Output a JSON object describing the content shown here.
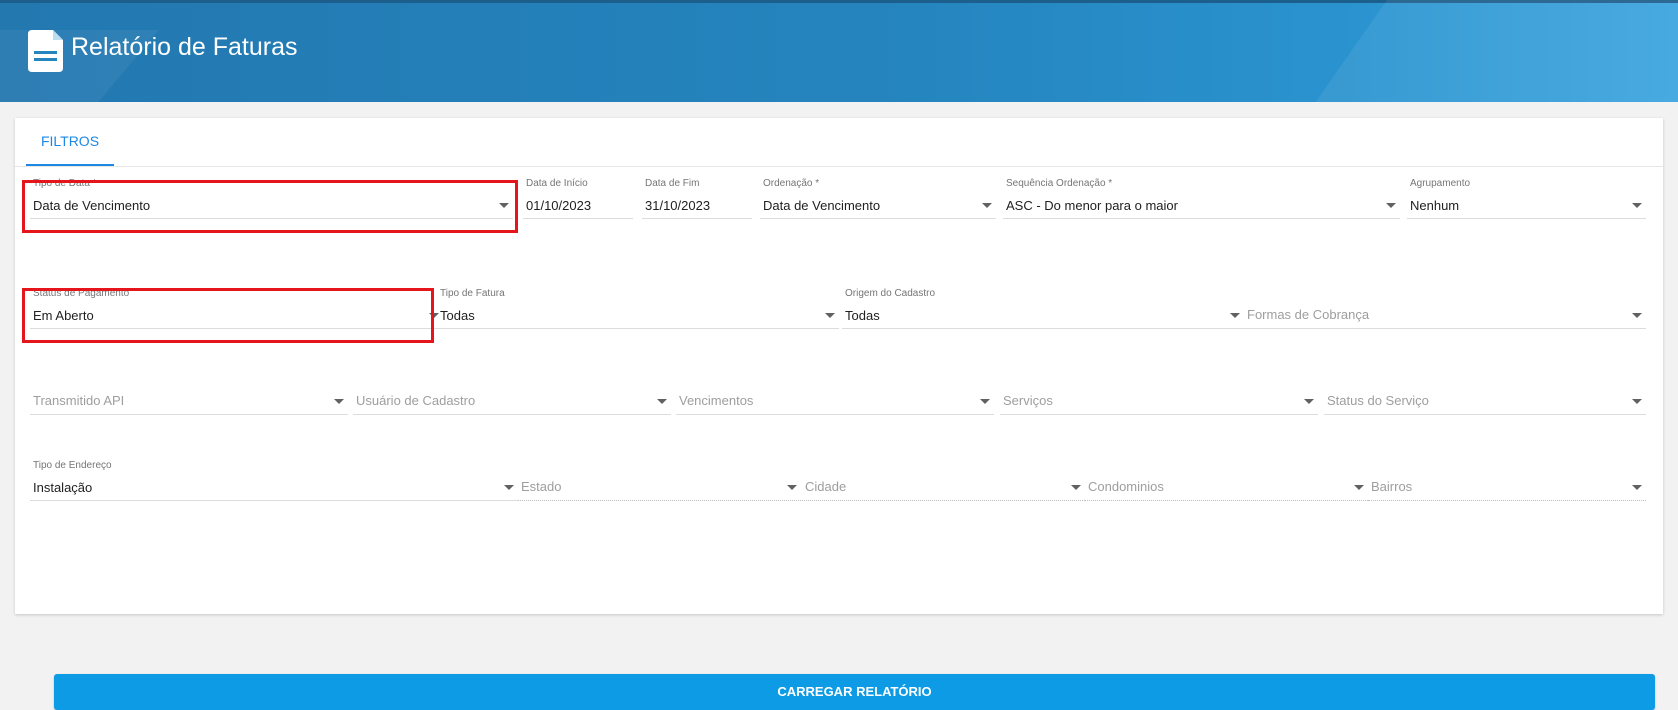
{
  "header": {
    "title": "Relatório de Faturas",
    "icon": "document-icon"
  },
  "tabs": [
    {
      "label": "FILTROS"
    }
  ],
  "filters": {
    "tipo_data": {
      "label": "Tipo de Data *",
      "value": "Data de Vencimento"
    },
    "data_inicio": {
      "label": "Data de Início",
      "value": "01/10/2023"
    },
    "data_fim": {
      "label": "Data de Fim",
      "value": "31/10/2023"
    },
    "ordenacao": {
      "label": "Ordenação *",
      "value": "Data de Vencimento"
    },
    "sequencia_ordenacao": {
      "label": "Sequência Ordenação *",
      "value": "ASC - Do menor para o maior"
    },
    "agrupamento": {
      "label": "Agrupamento",
      "value": "Nenhum"
    },
    "status_pagamento": {
      "label": "Status de Pagamento",
      "value": "Em Aberto"
    },
    "tipo_fatura": {
      "label": "Tipo de Fatura",
      "value": "Todas"
    },
    "origem_cadastro": {
      "label": "Origem do Cadastro",
      "value": "Todas"
    },
    "formas_cobranca": {
      "placeholder": "Formas de Cobrança"
    },
    "transmitido_api": {
      "placeholder": "Transmitido API"
    },
    "usuario_cadastro": {
      "placeholder": "Usuário de Cadastro"
    },
    "vencimentos": {
      "placeholder": "Vencimentos"
    },
    "servicos": {
      "placeholder": "Serviços"
    },
    "status_servico": {
      "placeholder": "Status do Serviço"
    },
    "tipo_endereco": {
      "label": "Tipo de Endereço",
      "value": "Instalação"
    },
    "estado": {
      "placeholder": "Estado"
    },
    "cidade": {
      "placeholder": "Cidade"
    },
    "condominios": {
      "placeholder": "Condominios"
    },
    "bairros": {
      "placeholder": "Bairros"
    }
  },
  "actions": {
    "load_report": "CARREGAR RELATÓRIO"
  },
  "colors": {
    "header": "#2585bf",
    "accent": "#1e88e5",
    "button": "#0d9be6",
    "highlight": "#e4161c"
  }
}
